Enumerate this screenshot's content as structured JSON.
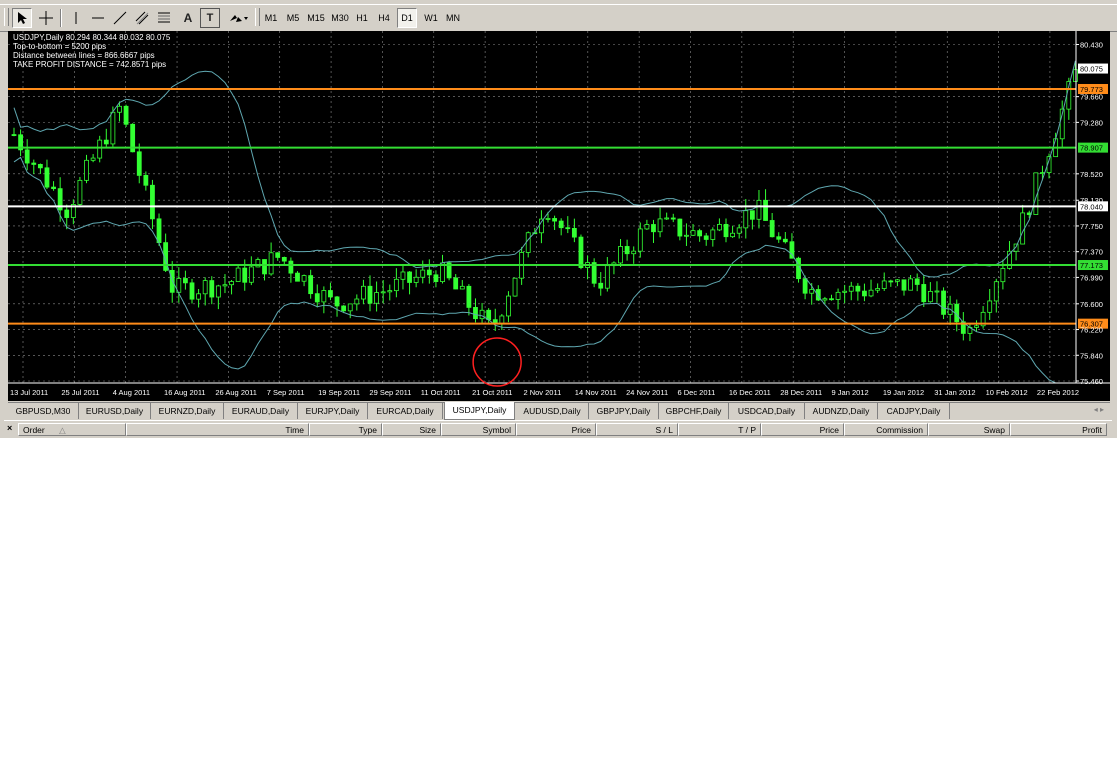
{
  "toolbar": {
    "tools": [
      {
        "icon": "cursor-arrow-icon"
      },
      {
        "icon": "crosshair-icon"
      },
      {
        "icon": "vertical-line-icon"
      },
      {
        "icon": "horizontal-line-icon"
      },
      {
        "icon": "trendline-icon"
      },
      {
        "icon": "equidistant-channel-icon"
      },
      {
        "icon": "fibonacci-icon"
      },
      {
        "icon": "text-icon",
        "label": "A"
      },
      {
        "icon": "text-label-icon",
        "label": "T"
      },
      {
        "icon": "arrows-dropdown-icon"
      }
    ],
    "timeframes": [
      "M1",
      "M5",
      "M15",
      "M30",
      "H1",
      "H4",
      "D1",
      "W1",
      "MN"
    ],
    "active_timeframe": "D1"
  },
  "chart": {
    "info_lines": [
      "USDJPY,Daily  80.294 80.344 80.032 80.075",
      "Top-to-bottom = 5200 pips",
      "Distance between lines = 866.6667 pips",
      "TAKE PROFIT DISTANCE = 742.8571 pips"
    ],
    "price_scale": [
      "80.430",
      "79.660",
      "79.280",
      "78.520",
      "78.130",
      "77.750",
      "77.370",
      "76.990",
      "76.600",
      "76.220",
      "75.840",
      "75.460"
    ],
    "date_axis": [
      "13 Jul 2011",
      "25 Jul 2011",
      "4 Aug 2011",
      "16 Aug 2011",
      "26 Aug 2011",
      "7 Sep 2011",
      "19 Sep 2011",
      "29 Sep 2011",
      "11 Oct 2011",
      "21 Oct 2011",
      "2 Nov 2011",
      "14 Nov 2011",
      "24 Nov 2011",
      "6 Dec 2011",
      "16 Dec 2011",
      "28 Dec 2011",
      "9 Jan 2012",
      "19 Jan 2012",
      "31 Jan 2012",
      "10 Feb 2012",
      "22 Feb 2012"
    ],
    "current_price": "80.075",
    "horizontal_lines": [
      {
        "price": "79.773",
        "color": "#ff8c1a"
      },
      {
        "price": "78.907",
        "color": "#33dd33"
      },
      {
        "price": "78.040",
        "color": "#ffffff"
      },
      {
        "price": "77.173",
        "color": "#33dd33"
      },
      {
        "price": "76.307",
        "color": "#ff8c1a"
      }
    ],
    "colors": {
      "background": "#000000",
      "grid": "#8a8a8a",
      "candles": "#33ff33",
      "bollinger": "#5fa7b0",
      "marker_circle": "#ff2020"
    },
    "marker": "red-circle-annotation"
  },
  "chart_data": {
    "type": "candlestick",
    "symbol": "USDJPY",
    "timeframe": "Daily",
    "x": [
      "13 Jul 2011",
      "25 Jul 2011",
      "4 Aug 2011",
      "16 Aug 2011",
      "26 Aug 2011",
      "7 Sep 2011",
      "19 Sep 2011",
      "29 Sep 2011",
      "11 Oct 2011",
      "21 Oct 2011",
      "2 Nov 2011",
      "14 Nov 2011",
      "24 Nov 2011",
      "6 Dec 2011",
      "16 Dec 2011",
      "28 Dec 2011",
      "9 Jan 2012",
      "19 Jan 2012",
      "31 Jan 2012",
      "10 Feb 2012",
      "22 Feb 2012"
    ],
    "close": [
      79.1,
      78.0,
      79.5,
      76.8,
      76.9,
      77.3,
      76.6,
      76.8,
      77.1,
      76.2,
      78.1,
      76.9,
      77.8,
      77.6,
      78.0,
      76.8,
      76.8,
      76.9,
      76.2,
      77.8,
      80.0
    ],
    "ylim": [
      75.46,
      80.6
    ],
    "grid": true
  },
  "tabs": [
    "GBPUSD,M30",
    "EURUSD,Daily",
    "EURNZD,Daily",
    "EURAUD,Daily",
    "EURJPY,Daily",
    "EURCAD,Daily",
    "USDJPY,Daily",
    "AUDUSD,Daily",
    "GBPJPY,Daily",
    "GBPCHF,Daily",
    "USDCAD,Daily",
    "AUDNZD,Daily",
    "CADJPY,Daily"
  ],
  "active_tab": "USDJPY,Daily",
  "terminal": {
    "close_label": "×",
    "columns": [
      "Order",
      "Time",
      "Type",
      "Size",
      "Symbol",
      "Price",
      "S / L",
      "T / P",
      "Price",
      "Commission",
      "Swap",
      "Profit"
    ]
  }
}
